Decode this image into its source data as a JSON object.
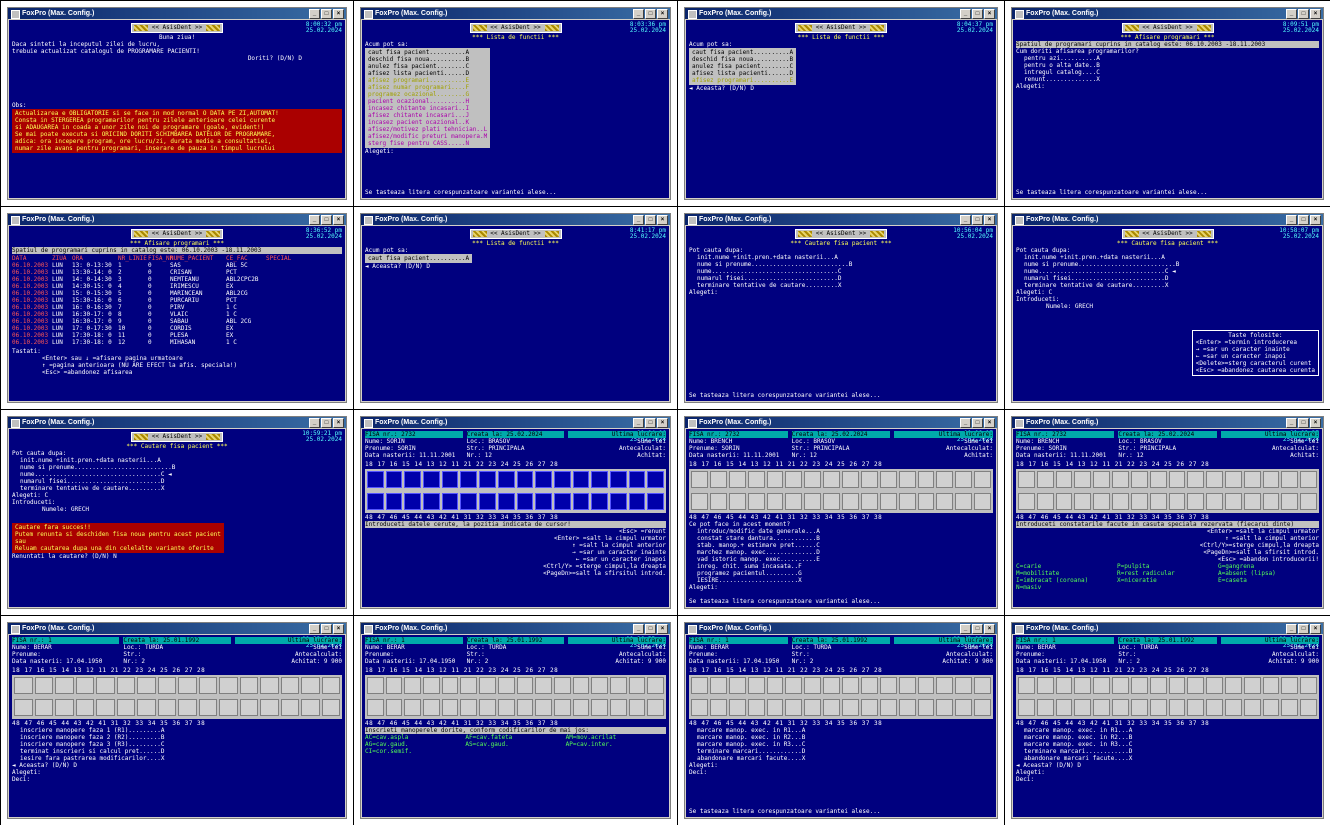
{
  "window_title": "FoxPro (Max. Config.)",
  "banner": "<< AsisDent >>",
  "panels": [
    {
      "clock": "8:00:32 pm",
      "date": "25.02.2024",
      "lines": [
        "Buna ziua!",
        "Daca sinteti la inceputul zilei de lucru,",
        "trebuie actualizat catalogul de PROGRAMARE PACIENTI!",
        "Doriti? (D/N) D"
      ],
      "obs_label": "Obs:",
      "notes": [
        "Actualizarea e OBLIGATORIE si se face in mod normal O DATA PE ZI,AUTOMAT!",
        "Consta in STERGEREA programarilor pentru zilele anterioare celei curente",
        "si ADAUGAREA in coada a unor zile noi de programare (goale, evident!)",
        "Se mai poate executa si ORICIND DORITI SCHIMBAREA DATELOR DE PROGRAMARE,",
        "adica: ora incepere program, ore lucru/zi, durata medie a consultatiei,",
        "numar zile avans pentru programari, inserare de pauza in timpul lucrului"
      ]
    },
    {
      "clock": "8:03:36 pm",
      "date": "25.02.2024",
      "title": "*** Lista de functii ***",
      "prompt": "Acum pot sa:",
      "items": [
        "caut fisa pacient..........A",
        "deschid fisa noua..........B",
        "anulez fisa pacient........C",
        "afisez lista pacienti......D",
        "afisez programari..........E",
        "afisez numar programari....F",
        "programez ocazional........G",
        "pacient ocazional..........H",
        "incasez chitante incasari..I",
        "afisez chitante incasari...J",
        "incasez pacient ocazional..K",
        "afisez/motivez plati tehnician..L",
        "afisez/modific preturi manopera.M",
        "sterg fise pentru CASS.....N"
      ],
      "alegeti": "Alegeti:",
      "hint": "Se tasteaza litera corespunzatoare variantei alese..."
    },
    {
      "clock": "8:04:37 pm",
      "date": "25.02.2024",
      "title": "*** Lista de functii ***",
      "prompt": "Acum pot sa:",
      "items": [
        "caut fisa pacient..........A",
        "deschid fisa noua..........B",
        "anulez fisa pacient........C",
        "afisez lista pacienti......D",
        "afisez programari..........E"
      ],
      "confirm": "◄ Aceasta? (D/N) D"
    },
    {
      "clock": "8:09:51 pm",
      "date": "25.02.2024",
      "title": "*** Afisare programari ***",
      "period": "Spatiul de programari cuprins in catalog este: 06.10.2003 -18.11.2003",
      "question": "Cum doriti afisarea programarilor?",
      "items": [
        "pentru azi..........A",
        "pentru o alta date..B",
        "intregul catalog....C",
        "renunt..............X"
      ],
      "alegeti": "Alegeti:",
      "hint": "Se tasteaza litera corespunzatoare variantei alese..."
    },
    {
      "clock": "8:36:52 pm",
      "date": "25.02.2024",
      "title": "*** Afisare programari ***",
      "period": "Spatiul de programari cuprins in catalog este: 06.10.2003 -18.11.2003",
      "headers": [
        "DATA",
        "ZIUA",
        "ORA",
        "NR_LINIE",
        "FISA_NR",
        "NUME_PACIENT",
        "CE_FAC",
        "SPECIAL"
      ],
      "rows": [
        [
          "06.10.2003",
          "LUN",
          "13: 0-13:30",
          "1",
          "0",
          "SAS",
          "ABL 5C"
        ],
        [
          "06.10.2003",
          "LUN",
          "13:30-14: 0",
          "2",
          "0",
          "CRISAN",
          "PCT"
        ],
        [
          "06.10.2003",
          "LUN",
          "14: 0-14:30",
          "3",
          "0",
          "NEMTEANU",
          "ABL2CPC2B"
        ],
        [
          "06.10.2003",
          "LUN",
          "14:30-15: 0",
          "4",
          "0",
          "IRIMESCU",
          "EX"
        ],
        [
          "06.10.2003",
          "LUN",
          "15: 0-15:30",
          "5",
          "0",
          "MARINCEAN",
          "ABL2CG"
        ],
        [
          "06.10.2003",
          "LUN",
          "15:30-16: 0",
          "6",
          "0",
          "PURCARIU",
          "PCT"
        ],
        [
          "06.10.2003",
          "LUN",
          "16: 0-16:30",
          "7",
          "0",
          "PIRV",
          "1 C"
        ],
        [
          "06.10.2003",
          "LUN",
          "16:30-17: 0",
          "8",
          "0",
          "VLAIC",
          "1 C"
        ],
        [
          "06.10.2003",
          "LUN",
          "16:30-17: 0",
          "9",
          "0",
          "SABAU",
          "ABL 2CG"
        ],
        [
          "06.10.2003",
          "LUN",
          "17: 0-17:30",
          "10",
          "0",
          "CORDIS",
          "EX"
        ],
        [
          "06.10.2003",
          "LUN",
          "17:30-18: 0",
          "11",
          "0",
          "PLESA",
          "EX"
        ],
        [
          "06.10.2003",
          "LUN",
          "17:30-18: 0",
          "12",
          "0",
          "MIHASAN",
          "1 C"
        ]
      ],
      "keys_label": "Tastati:",
      "keys": [
        "<Enter> sau ↓ =afisare pagina urmatoare",
        "↑ =pagina anterioara (NU ARE EFECT la afis. speciala!)",
        "<Esc> =abandonez afisarea"
      ]
    },
    {
      "clock": "8:41:17 pm",
      "date": "25.02.2024",
      "title": "*** Lista de functii ***",
      "prompt": "Acum pot sa:",
      "items": [
        "caut fisa pacient..........A"
      ],
      "confirm": "◄ Aceasta? (D/N) D"
    },
    {
      "clock": "10:56:04 pm",
      "date": "25.02.2024",
      "title": "*** Cautare fisa pacient ***",
      "prompt": "Pot cauta dupa:",
      "items": [
        "init.nume +init.pren.+data nasterii...A",
        "nume si prenume...........................B",
        "nume...................................C",
        "numarul fisei..........................D",
        "terminare tentative de cautare.........X"
      ],
      "alegeti": "Alegeti:",
      "hint": "Se tasteaza litera corespunzatoare variantei alese..."
    },
    {
      "clock": "10:58:07 pm",
      "date": "25.02.2024",
      "title": "*** Cautare fisa pacient ***",
      "prompt": "Pot cauta dupa:",
      "items": [
        "init.nume +init.pren.+data nasterii...A",
        "nume si prenume...........................B",
        "nume...................................C ◄",
        "numarul fisei..........................D",
        "terminare tentative de cautare.........X"
      ],
      "alegeti": "Alegeti: C",
      "introduceti": "Introduceti:",
      "field": "Numele: GRECH",
      "keys_title": "Taste folosite:",
      "keys": [
        "<Enter> =termin introducerea",
        "→ =sar un caracter inainte",
        "← =sar un caracter inapoi",
        "<Delete>=sterg caracterul curent",
        "<Esc> =abandonez cautarea curenta"
      ]
    },
    {
      "clock": "10:59:21 pm",
      "date": "25.02.2024",
      "title": "*** Cautare fisa pacient ***",
      "prompt": "Pot cauta dupa:",
      "items": [
        "init.nume +init.pren.+data nasterii...A",
        "nume si prenume...........................B",
        "nume...................................C ◄",
        "numarul fisei..........................D",
        "terminare tentative de cautare.........X"
      ],
      "alegeti": "Alegeti: C",
      "introduceti": "Introduceti:",
      "field": "Numele: GRECH",
      "fail": "Cautare fara succes!!",
      "fail_lines": [
        "Putem renunta si deschiden fisa noua pentru acest pacient",
        "sau",
        "Reluam cautarea dupa una din celelalte variante oferite"
      ],
      "question": "Renuntati la cautare? (D/N) N"
    },
    {
      "fisa": "FISA nr.: 2732",
      "created": "Creata la: 25.02.2024",
      "last": "Ultima lucrare:",
      "clock": "11:04:06",
      "date": "25.02.2024",
      "name": "Nume: SORIN",
      "prenume": "Prenume: SORIN",
      "dob": "Data nasterii: 11.11.2001",
      "loc": "Loc.: BRASOV",
      "str": "Str.: PRINCIPALA",
      "nr": "Nr.: 12",
      "sume": "Sume lei",
      "antecalc": "Antecalculat:",
      "achitat": "Achitat:",
      "top_nums": "18 17 16 15 14 13 12 11 21 22 23 24 25 26 27 28",
      "bottom_nums": "48 47 46 45 44 43 42 41 31 32 33 34 35 36 37 38",
      "help": "Introduceti datele cerute, la pozitia indicata de cursor!",
      "keys": [
        "<Esc> =renunt",
        "<Enter> =salt la cimpul urmator",
        "↑ =salt la cimpul anterior",
        "→ =sar un caracter inainte",
        "← =sar un caracter inapoi",
        "<Ctrl/Y> =sterge cimpul,la dreapta",
        "<PageDn>=salt la sfirsitul introd."
      ]
    },
    {
      "fisa": "FISA nr.: 2732",
      "created": "Creata la: 25.02.2024",
      "last": "Ultima lucrare:",
      "clock": "11:06:17",
      "date": "25.02.2024",
      "name": "Nume: BRENCH",
      "prenume": "Prenume: SORIN",
      "dob": "Data nasterii: 11.11.2001",
      "loc": "Loc.: BRASOV",
      "str": "Str.: PRINCIPALA",
      "nr": "Nr.: 12",
      "sume": "Sume lei",
      "antecalc": "Antecalculat:",
      "achitat": "Achitat:",
      "top_nums": "18 17 16 15 14 13 12 11 21 22 23 24 25 26 27 28",
      "bottom_nums": "48 47 46 45 44 43 42 41 31 32 33 34 35 36 37 38",
      "question": "Ce pot face in acest moment?",
      "items": [
        "introduc/modific date generale...A",
        "constat stare dantura............B",
        "stab. manop.+ estimare pret......C",
        "marchez manop. exec..............D",
        "vad istoric manop. exec..........E",
        "inreg. chit. suma incasata..F",
        "programez pacientul.........G",
        "IESIRE......................X"
      ],
      "alegeti": "Alegeti:",
      "hint": "Se tasteaza litera corespunzatoare variantei alese..."
    },
    {
      "fisa": "FISA nr.: 2732",
      "created": "Creata la: 25.02.2024",
      "last": "Ultima lucrare:",
      "clock": "11:09:37",
      "date": "25.02.2024",
      "name": "Nume: BRENCH",
      "prenume": "Prenume: SORIN",
      "dob": "Data nasterii: 11.11.2001",
      "loc": "Loc.: BRASOV",
      "str": "Str.: PRINCIPALA",
      "nr": "Nr.: 12",
      "sume": "Sume lei",
      "antecalc": "Antecalculat:",
      "achitat": "Achitat:",
      "top_nums": "18 17 16 15 14 13 12 11 21 22 23 24 25 26 27 28",
      "bottom_nums": "48 47 46 45 44 43 42 41 31 32 33 34 35 36 37 38",
      "help": "Introduceti constatarile facute in casuta speciala rezervata (fiecarui dinte)",
      "codes": [
        "C=carie",
        "P=pulpita",
        "G=gangrena",
        "M=mobilitate",
        "R=rest radicular",
        "A=absent (lipsa)",
        "I=imbracat (coroana)",
        "X=niceratie",
        "E=caseta",
        "N=masiv"
      ],
      "keys": [
        "<Enter> =salt la cimpul urmator",
        "↑ =salt la cimpul anterior",
        "<Ctrl/Y>=sterge cimpul,la dreapta",
        "<PageDn>=salt la sfirsit introd.",
        "<Esc> =abandon introducerii!"
      ]
    },
    {
      "fisa": "FISA nr.: 1",
      "created": "Creata la: 25.01.1992",
      "last": "Ultima lucrare:",
      "clock": "11:33:54 pm",
      "date": "25.02.2024",
      "name": "Nume: BERAR",
      "prenume": "Prenume:",
      "dob": "Data nasterii: 17.04.1950",
      "loc": "Loc.: TURDA",
      "str": "Str.:",
      "nr": "Nr.: 2",
      "sume": "Sume lei",
      "antecalc": "Antecalculat:",
      "achitat": "Achitat: 9 900",
      "top_nums": "18 17 16 15 14 13 12 11 21 22 23 24 25 26 27 28",
      "bottom_nums": "48 47 46 45 44 43 42 41 31 32 33 34 35 36 37 38",
      "deci": "Deci:",
      "items": [
        "inscriere manopere faza 1 (R1).........A",
        "inscriere manopere faza 2 (R2).........B",
        "inscriere manopere faza 3 (R3).........C",
        "terminat inscrieri si calcul pret......D",
        "iesire fara pastrarea modificarilor....X"
      ],
      "confirm": "◄ Aceasta? (D/N) D",
      "alegeti": "Alegeti:"
    },
    {
      "fisa": "FISA nr.: 1",
      "created": "Creata la: 25.01.1992",
      "last": "Ultima lucrare:",
      "clock": "11:36:55 pm",
      "date": "25.02.2024",
      "name": "Nume: BERAR",
      "prenume": "Prenume:",
      "dob": "Data nasterii: 17.04.1950",
      "loc": "Loc.: TURDA",
      "str": "Str.:",
      "nr": "Nr.: 2",
      "sume": "Sume lei",
      "antecalc": "Antecalculat:",
      "achitat": "Achitat: 9 900",
      "top_nums": "18 17 16 15 14 13 12 11 21 22 23 24 25 26 27 28",
      "bottom_nums": "48 47 46 45 44 43 42 41 31 32 33 34 35 36 37 38",
      "help": "Inscrieti manoperele dorite, conform codificarilor de mai jos:",
      "codes": [
        "AC=cav.aspla",
        "AF=cav.fateta",
        "AM=mov.acrilat",
        "AG=cav.gaud.",
        "AS=cav.gaud.",
        "AP=cav.inter.",
        "CI=cor.semif."
      ]
    },
    {
      "fisa": "FISA nr.: 1",
      "created": "Creata la: 25.01.1992",
      "last": "Ultima lucrare:",
      "clock": "11:43:06 pm",
      "date": "25.02.2024",
      "name": "Nume: BERAR",
      "prenume": "Prenume:",
      "dob": "Data nasterii: 17.04.1950",
      "loc": "Loc.: TURDA",
      "str": "Str.:",
      "nr": "Nr.: 2",
      "sume": "Sume lei",
      "antecalc": "Antecalculat:",
      "achitat": "Achitat: 9 900",
      "top_nums": "18 17 16 15 14 13 12 11 21 22 23 24 25 26 27 28",
      "bottom_nums": "48 47 46 45 44 43 42 41 31 32 33 34 35 36 37 38",
      "deci": "Deci:",
      "items": [
        "marcare manop. exec. in R1...A",
        "marcare manop. exec. in R2...B",
        "marcare manop. exec. in R3...C",
        "terminare marcari............D",
        "abandonare marcari facute....X"
      ],
      "alegeti": "Alegeti:",
      "hint": "Se tasteaza litera corespunzatoare variantei alese..."
    },
    {
      "fisa": "FISA nr.: 1",
      "created": "Creata la: 25.01.1992",
      "last": "Ultima lucrare:",
      "clock": "11:50:56 pm",
      "date": "25.02.2024",
      "name": "Nume: BERAR",
      "prenume": "Prenume:",
      "dob": "Data nasterii: 17.04.1950",
      "loc": "Loc.: TURDA",
      "str": "Str.:",
      "nr": "Nr.: 2",
      "sume": "Sume lei",
      "antecalc": "Antecalculat:",
      "achitat": "Achitat: 9 900",
      "top_nums": "18 17 16 15 14 13 12 11 21 22 23 24 25 26 27 28",
      "bottom_nums": "48 47 46 45 44 43 42 41 31 32 33 34 35 36 37 38",
      "deci": "Deci:",
      "items": [
        "marcare manop. exec. in R1...A",
        "marcare manop. exec. in R2...B",
        "marcare manop. exec. in R3...C",
        "terminare marcari............D",
        "abandonare marcari facute....X"
      ],
      "confirm": "◄ Aceasta? (D/N) D",
      "alegeti": "Alegeti:"
    }
  ]
}
